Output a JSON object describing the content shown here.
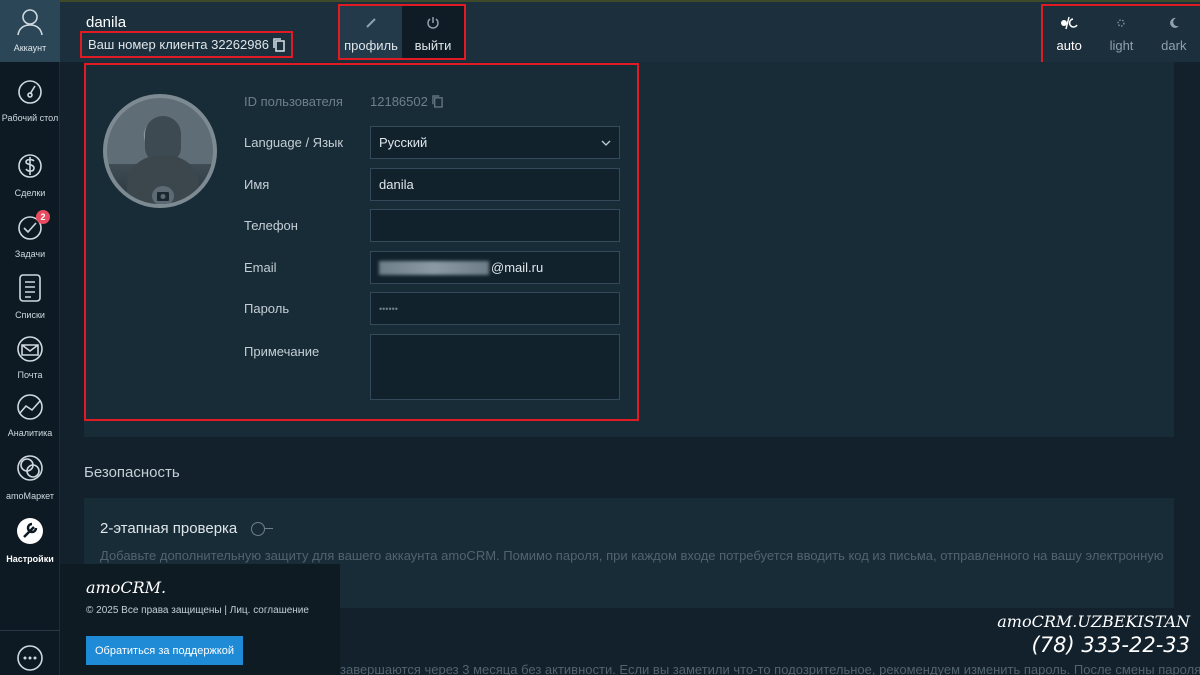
{
  "nav": {
    "account": "Аккаунт",
    "items": [
      {
        "label": "Рабочий стол",
        "icon": "dashboard-icon"
      },
      {
        "label": "Сделки",
        "icon": "dollar-icon"
      },
      {
        "label": "Задачи",
        "icon": "check-icon",
        "badge": "2"
      },
      {
        "label": "Списки",
        "icon": "list-icon"
      },
      {
        "label": "Почта",
        "icon": "mail-icon"
      },
      {
        "label": "Аналитика",
        "icon": "analytics-icon"
      },
      {
        "label": "amoМаркет",
        "icon": "market-icon"
      },
      {
        "label": "Настройки",
        "icon": "settings-icon"
      }
    ]
  },
  "header": {
    "username": "danila",
    "client_number": "Ваш номер клиента 32262986",
    "profile_btn": "профиль",
    "logout_btn": "выйти",
    "themes": [
      "auto",
      "light",
      "dark"
    ],
    "active_theme": "auto"
  },
  "profile": {
    "user_id_label": "ID пользователя",
    "user_id": "12186502",
    "language_label": "Language / Язык",
    "language": "Русский",
    "name_label": "Имя",
    "name": "danila",
    "phone_label": "Телефон",
    "phone": "",
    "email_label": "Email",
    "email_suffix": "@mail.ru",
    "password_label": "Пароль",
    "password": "••••••",
    "note_label": "Примечание",
    "note": ""
  },
  "security": {
    "title": "Безопасность",
    "twostep": "2-этапная проверка",
    "description": "Добавьте дополнительную защиту для вашего аккаунта amoCRM. Помимо пароля, при каждом входе потребуется вводить код из письма, отправленного на вашу электронную",
    "session_text": "завершаются через 3 месяца без активности. Если вы заметили что-то подозрительное, рекомендуем изменить пароль. После смены пароля"
  },
  "footer": {
    "logo": "amoCRM.",
    "copyright": "© 2025 Все права защищены | Лиц. соглашение",
    "support": "Обратиться за поддержкой"
  },
  "watermark": {
    "brand": "amoCRM.UZBEKISTAN",
    "phone": "(78) 333-22-33"
  },
  "colors": {
    "accent": "#1f8ad5",
    "highlight": "#e01b24",
    "badge": "#e84a5f"
  }
}
